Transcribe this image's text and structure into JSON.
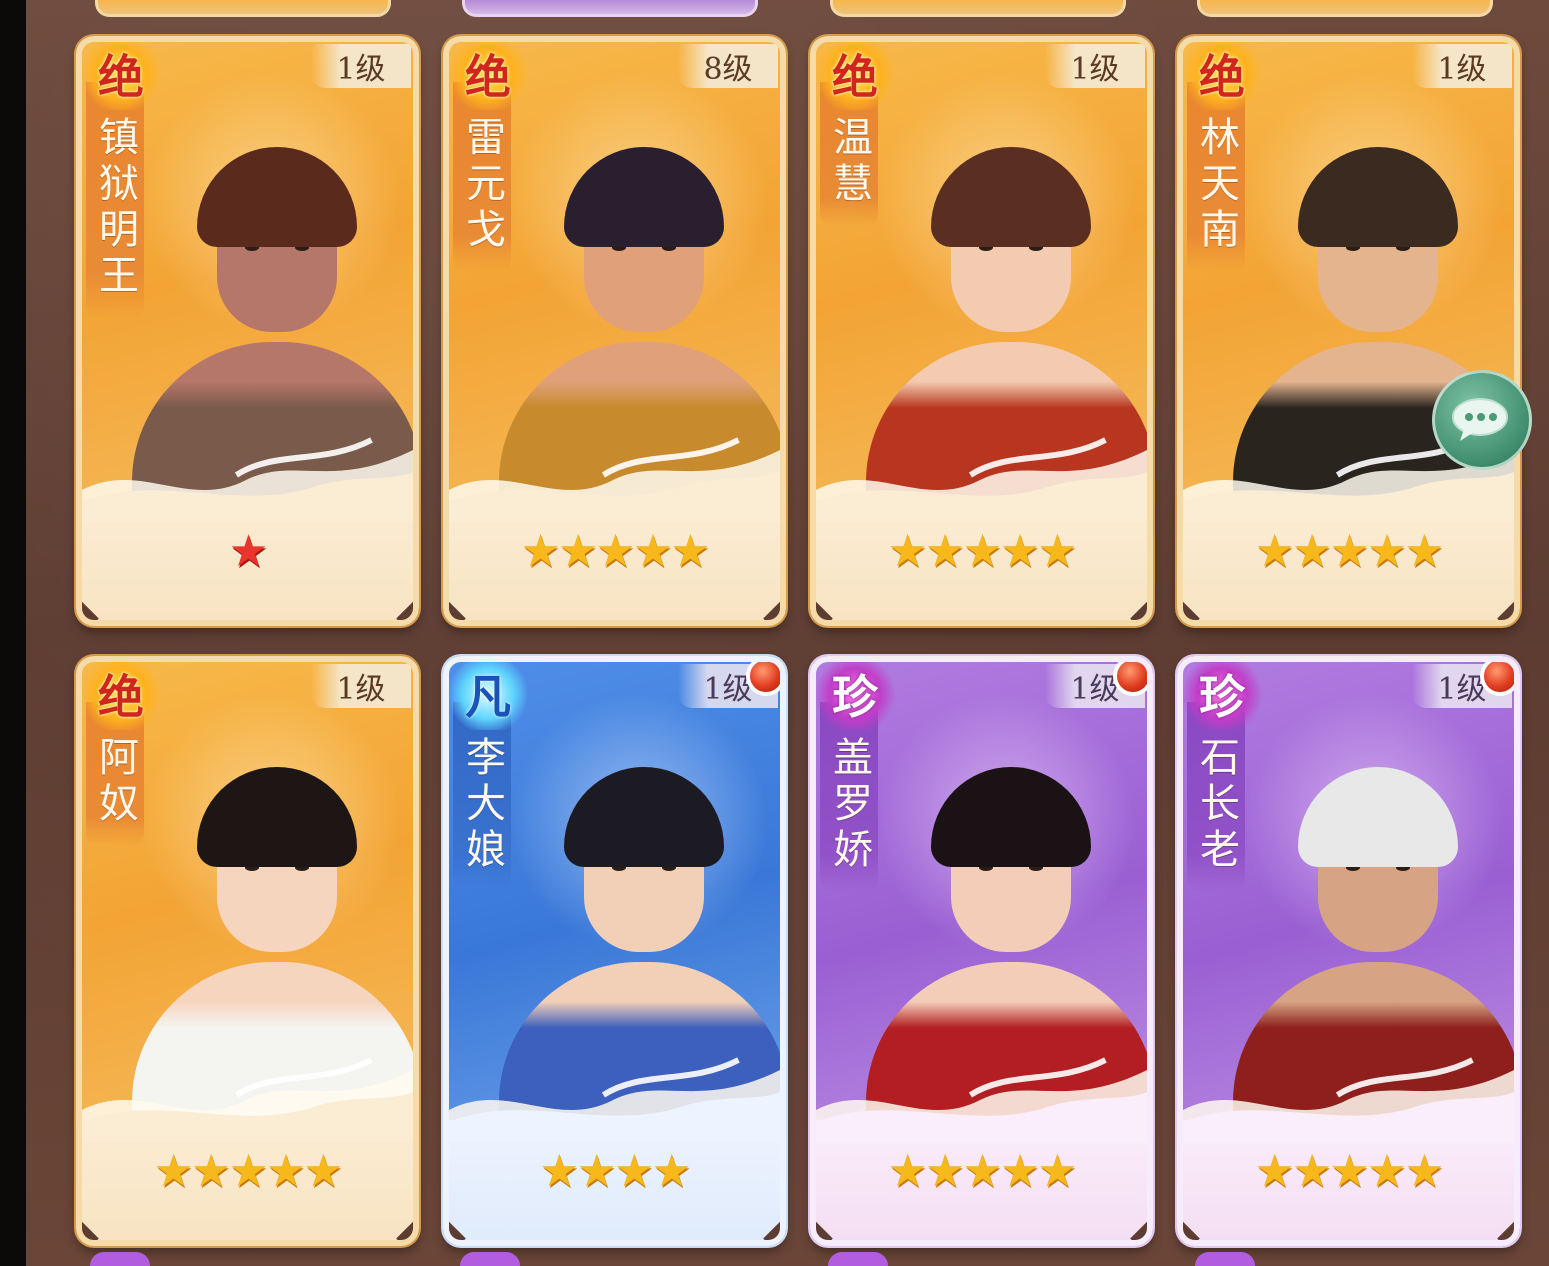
{
  "heroes": [
    {
      "name": "镇狱明王",
      "rarity": "绝",
      "level": "1级",
      "stars": 1,
      "star_color": "red",
      "skin": "#b5776a",
      "hair": "#5a2b1c",
      "cloth": "#7a5a4a",
      "new_badge": false
    },
    {
      "name": "雷元戈",
      "rarity": "绝",
      "level": "8级",
      "stars": 5,
      "star_color": "gold",
      "skin": "#e0a17a",
      "hair": "#2a1f2e",
      "cloth": "#c78a2c",
      "new_badge": false
    },
    {
      "name": "温慧",
      "rarity": "绝",
      "level": "1级",
      "stars": 5,
      "star_color": "gold",
      "skin": "#f3cbb0",
      "hair": "#5a2f22",
      "cloth": "#b8361f",
      "new_badge": false
    },
    {
      "name": "林天南",
      "rarity": "绝",
      "level": "1级",
      "stars": 5,
      "star_color": "gold",
      "skin": "#e3b48e",
      "hair": "#3a2a20",
      "cloth": "#2a241f",
      "new_badge": false
    },
    {
      "name": "阿奴",
      "rarity": "绝",
      "level": "1级",
      "stars": 5,
      "star_color": "gold",
      "skin": "#f6d5bf",
      "hair": "#1e1614",
      "cloth": "#f4f4f0",
      "new_badge": false
    },
    {
      "name": "李大娘",
      "rarity": "凡",
      "level": "1级",
      "stars": 4,
      "star_color": "gold",
      "skin": "#f2d0b7",
      "hair": "#1c1a22",
      "cloth": "#3d5fbd",
      "new_badge": true
    },
    {
      "name": "盖罗娇",
      "rarity": "珍",
      "level": "1级",
      "stars": 5,
      "star_color": "gold",
      "skin": "#f3cdb8",
      "hair": "#1a1214",
      "cloth": "#b21e22",
      "new_badge": true
    },
    {
      "name": "石长老",
      "rarity": "珍",
      "level": "1级",
      "stars": 5,
      "star_color": "gold",
      "skin": "#d6a484",
      "hair": "#e8e8e8",
      "cloth": "#8e1f1c",
      "new_badge": true
    }
  ],
  "chat_icon": "chat-bubble-icon",
  "star_glyph": "★"
}
